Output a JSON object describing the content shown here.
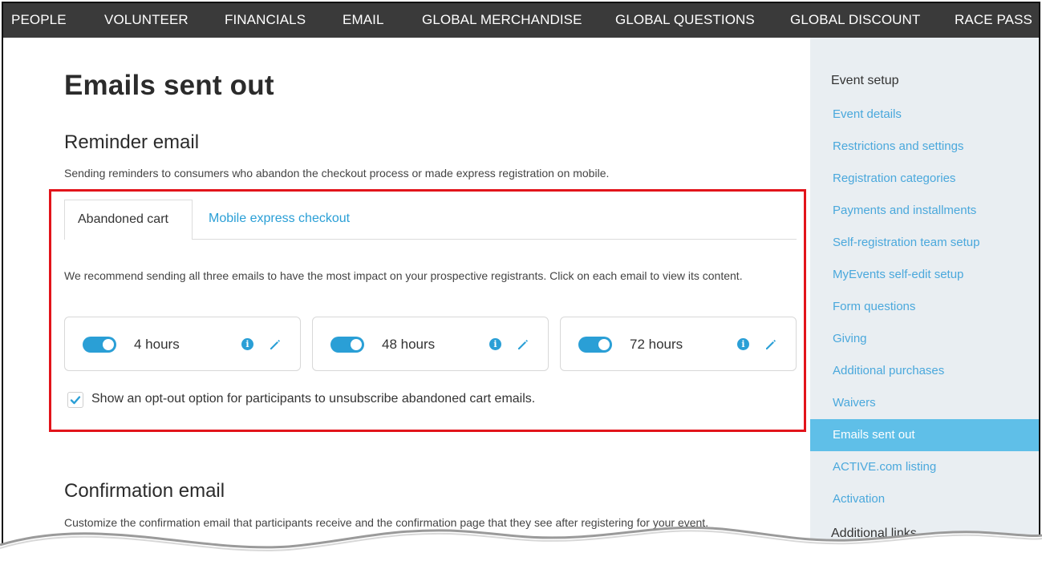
{
  "topnav": {
    "items": [
      "PEOPLE",
      "VOLUNTEER",
      "FINANCIALS",
      "EMAIL",
      "GLOBAL MERCHANDISE",
      "GLOBAL QUESTIONS",
      "GLOBAL DISCOUNT",
      "RACE PASS"
    ]
  },
  "main": {
    "title": "Emails sent out",
    "reminder": {
      "title": "Reminder email",
      "description": "Sending reminders to consumers who abandon the checkout process or made express registration on mobile.",
      "tabs": [
        {
          "label": "Abandoned cart",
          "active": true
        },
        {
          "label": "Mobile express checkout",
          "active": false
        }
      ],
      "recommend": "We recommend sending all three emails to have the most impact on your prospective registrants. Click on each email to view its content.",
      "cards": [
        {
          "label": "4 hours",
          "enabled": true,
          "info_icon": "info-icon",
          "edit_icon": "pencil-icon"
        },
        {
          "label": "48 hours",
          "enabled": true,
          "info_icon": "info-icon",
          "edit_icon": "pencil-icon"
        },
        {
          "label": "72 hours",
          "enabled": true,
          "info_icon": "info-icon",
          "edit_icon": "pencil-icon"
        }
      ],
      "optout": {
        "label": "Show an opt-out option for participants to unsubscribe abandoned cart emails.",
        "checked": true
      }
    },
    "confirmation": {
      "title": "Confirmation email",
      "description": "Customize the confirmation email that participants receive and the confirmation page that they see after registering for your event."
    }
  },
  "sidebar": {
    "heading": "Event setup",
    "items": [
      {
        "label": "Event details"
      },
      {
        "label": "Restrictions and settings"
      },
      {
        "label": "Registration categories"
      },
      {
        "label": "Payments and installments"
      },
      {
        "label": "Self-registration team setup"
      },
      {
        "label": "MyEvents self-edit setup"
      },
      {
        "label": "Form questions"
      },
      {
        "label": "Giving"
      },
      {
        "label": "Additional purchases"
      },
      {
        "label": "Waivers"
      },
      {
        "label": "Emails sent out",
        "active": true
      },
      {
        "label": "ACTIVE.com listing"
      },
      {
        "label": "Activation"
      }
    ],
    "heading2": "Additional links"
  },
  "colors": {
    "accent": "#2a9fd6",
    "nav_bg": "#3a3a3a",
    "sidebar_bg": "#e9eef2",
    "sidebar_active": "#5fbfe8",
    "highlight_border": "#e2141b"
  }
}
